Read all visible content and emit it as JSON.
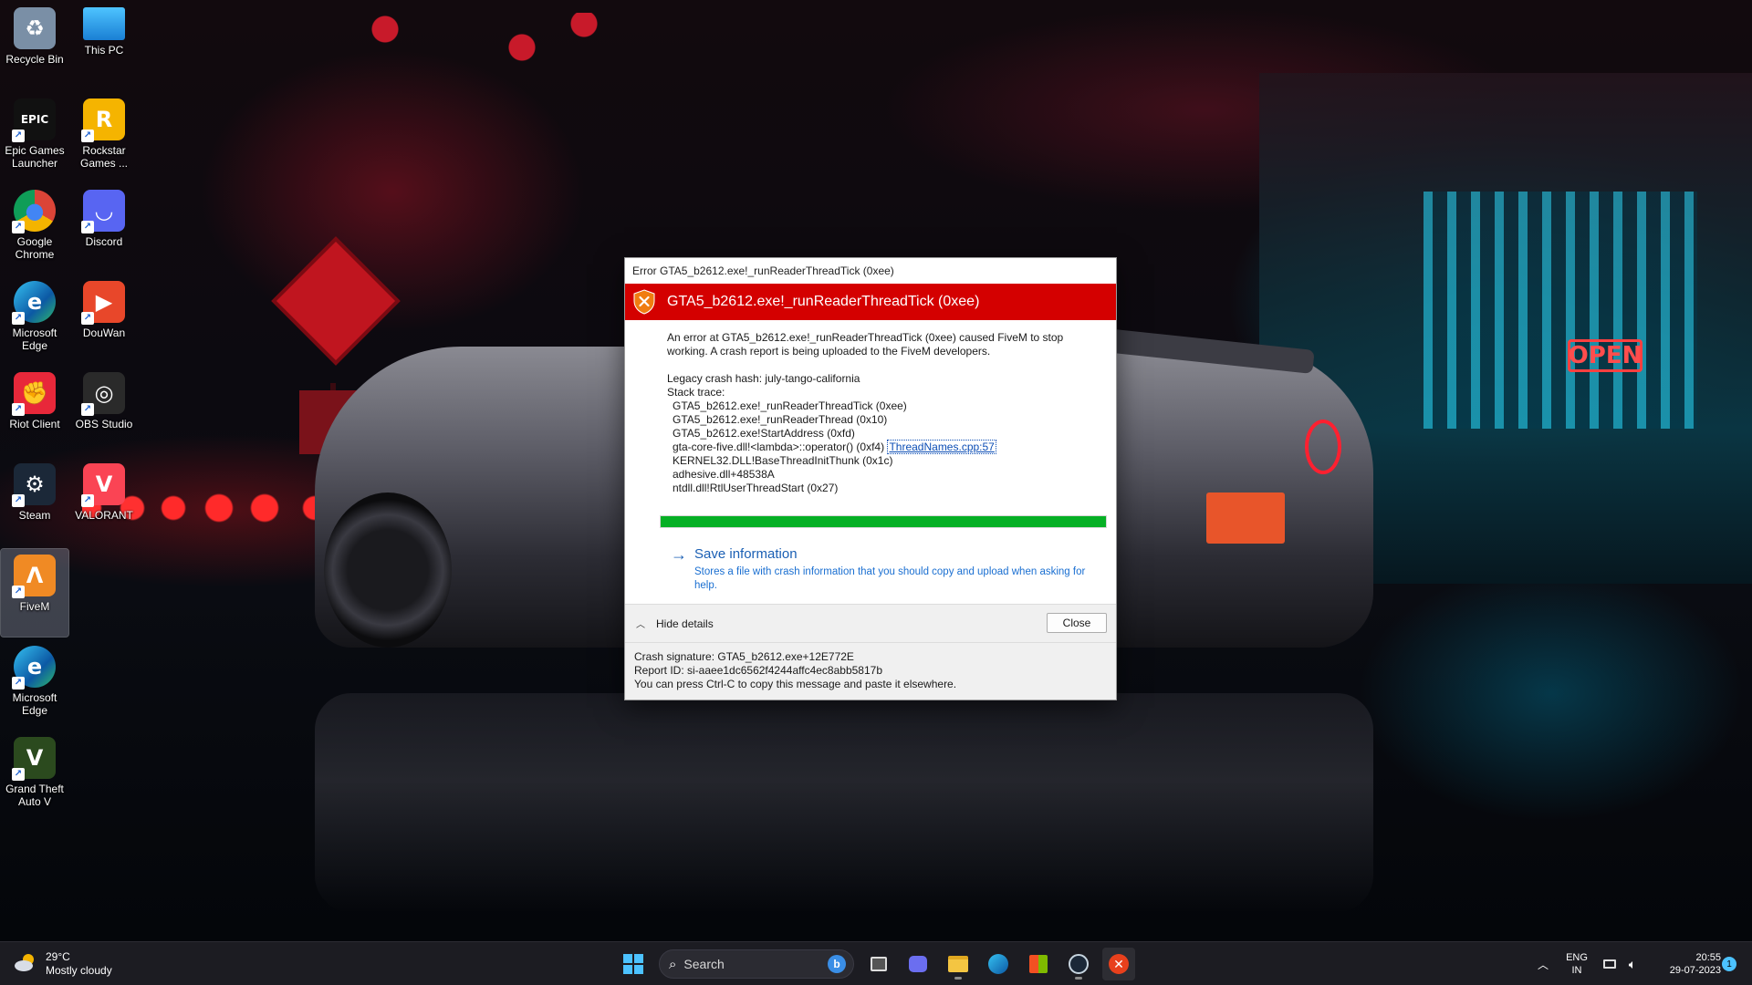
{
  "desktop": {
    "icons": [
      {
        "label": "Recycle Bin",
        "glyph": "♻",
        "icon": "recycle-bin-icon",
        "color": "#7a8fa6"
      },
      {
        "label": "This PC",
        "glyph": "",
        "icon": "this-pc-icon",
        "color": "#2aa3e8"
      },
      {
        "label": "Epic Games\nLauncher",
        "glyph": "EPIC",
        "icon": "epic-games-icon",
        "color": "#111111"
      },
      {
        "label": "Rockstar\nGames ...",
        "glyph": "R",
        "icon": "rockstar-icon",
        "color": "#f5b400"
      },
      {
        "label": "Google\nChrome",
        "glyph": "●",
        "icon": "chrome-icon",
        "color": "#ffffff"
      },
      {
        "label": "Discord",
        "glyph": "◡",
        "icon": "discord-icon",
        "color": "#5865f2"
      },
      {
        "label": "Microsoft\nEdge",
        "glyph": "e",
        "icon": "edge-icon",
        "color": "#0c8ad8"
      },
      {
        "label": "DouWan",
        "glyph": "▶",
        "icon": "douwan-icon",
        "color": "#e8472a"
      },
      {
        "label": "Riot Client",
        "glyph": "✊",
        "icon": "riot-client-icon",
        "color": "#e8283a"
      },
      {
        "label": "OBS Studio",
        "glyph": "◎",
        "icon": "obs-studio-icon",
        "color": "#2a2a2a"
      },
      {
        "label": "Steam",
        "glyph": "⚙",
        "icon": "steam-icon",
        "color": "#1b2838"
      },
      {
        "label": "VALORANT",
        "glyph": "V",
        "icon": "valorant-icon",
        "color": "#fa4454"
      },
      {
        "label": "FiveM",
        "glyph": "Λ",
        "icon": "fivem-icon",
        "color": "#f08a24"
      },
      {
        "label": "Microsoft\nEdge",
        "glyph": "e",
        "icon": "edge-icon",
        "color": "#0c8ad8"
      },
      {
        "label": "Grand Theft\nAuto V",
        "glyph": "V",
        "icon": "gta-v-icon",
        "color": "#2b4a1e"
      }
    ]
  },
  "dialog": {
    "window_title": "Error GTA5_b2612.exe!_runReaderThreadTick (0xee)",
    "header": "GTA5_b2612.exe!_runReaderThreadTick (0xee)",
    "message": "An error at GTA5_b2612.exe!_runReaderThreadTick (0xee) caused FiveM to stop working. A crash report is being uploaded to the FiveM developers.",
    "crash_hash": "Legacy crash hash: july-tango-california",
    "stack_title": "Stack trace:",
    "stack": [
      "GTA5_b2612.exe!_runReaderThreadTick (0xee)",
      "GTA5_b2612.exe!_runReaderThread (0x10)",
      "GTA5_b2612.exe!StartAddress (0xfd)",
      "gta-core-five.dll!<lambda>::operator() (0xf4)",
      "KERNEL32.DLL!BaseThreadInitThunk (0x1c)",
      "adhesive.dll+48538A",
      "ntdll.dll!RtlUserThreadStart (0x27)"
    ],
    "stack_link": "ThreadNames.cpp:57",
    "progress": 1.0,
    "save_title": "Save information",
    "save_desc": "Stores a file with crash information that you should copy and upload when asking for help.",
    "hide_details": "Hide details",
    "close": "Close",
    "details": [
      "Crash signature: GTA5_b2612.exe+12E772E",
      "Report ID: si-aaee1dc6562f4244affc4ec8abb5817b",
      "You can press Ctrl-C to copy this message and paste it elsewhere."
    ],
    "colors": {
      "header": "#d40000",
      "progress": "#06b025",
      "link": "#1a5fb4"
    }
  },
  "taskbar": {
    "weather_temp": "29°C",
    "weather_desc": "Mostly cloudy",
    "search_placeholder": "Search",
    "apps": [
      "start-icon",
      "task-view-icon",
      "chat-icon",
      "file-explorer-icon",
      "edge-icon",
      "store-icon",
      "steam-icon",
      "fivem-error-icon"
    ],
    "lang": "ENG",
    "region": "IN",
    "time": "20:55",
    "date": "29-07-2023",
    "notification_count": "1"
  }
}
